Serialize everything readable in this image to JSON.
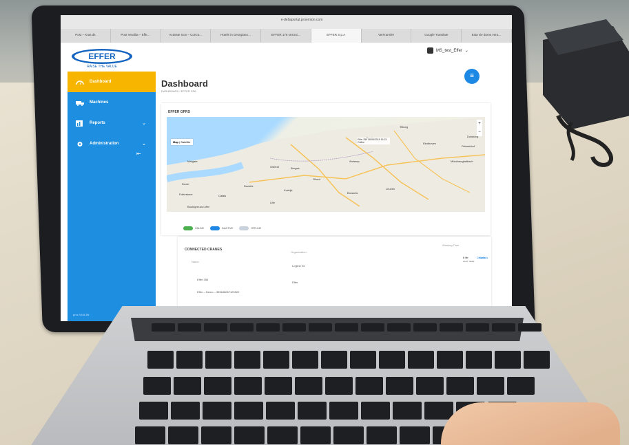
{
  "browser": {
    "url": "e-deltaportal.proemion.com",
    "tabs": [
      "Post – Kras.ds",
      "Post Vendita – Effe…",
      "Activate Icon – Conca…",
      "Hotels in Georgiano…",
      "EFFER 175 sezoni…",
      "EFFER S.p.A",
      "VetTransfer",
      "Google Translate",
      "Esta vie dome vera…"
    ],
    "active_tab_index": 5
  },
  "app": {
    "logo_text": "EFFER",
    "logo_tagline": "RAISE THE VALUE",
    "user_name": "MS_test_Effer",
    "version": "proc V4.8.3N"
  },
  "sidebar": {
    "items": [
      {
        "label": "Dashboard",
        "icon": "gauge-icon",
        "active": true
      },
      {
        "label": "Machines",
        "icon": "truck-icon",
        "active": false
      },
      {
        "label": "Reports",
        "icon": "chart-icon",
        "active": false,
        "expandable": true
      },
      {
        "label": "Administration",
        "icon": "gear-icon",
        "active": false,
        "expandable": true
      }
    ]
  },
  "page": {
    "title": "Dashboard",
    "breadcrumb": "DASHBOARD / EFFER SPA"
  },
  "map_card": {
    "title": "EFFER GPRS",
    "map_type_label": "Map",
    "map_type_alt": "Satellite",
    "places": [
      "Margate",
      "Dover",
      "Calais",
      "Boulogne-sur-Mer",
      "Dunkirk",
      "Ostend",
      "Bruges",
      "Ghent",
      "Antwerp",
      "Brussels",
      "Breda",
      "Tilburg",
      "Eindhoven",
      "Düsseldorf",
      "Mönchengladbach",
      "Duisburg",
      "Leuven",
      "Lille",
      "Kortrijk",
      "Folkestone"
    ],
    "marker_text": "Effer 355 06/06/2018 16:23 Online",
    "legend": [
      "ONLINE",
      "INACTIVE",
      "OFFLINE"
    ]
  },
  "cranes_card": {
    "title": "CONNECTED CRANES",
    "column_name": "Name",
    "column_org": "Organization",
    "column_working_time": "Working Time",
    "details_label": "Details",
    "rows": [
      {
        "name": "Effer 355",
        "org": "Logline rte",
        "working": "0 Hr",
        "working_sub": "LAST YEAR"
      },
      {
        "name": "Effer – Demo – 353648067129522",
        "org": "Effer",
        "working": "",
        "working_sub": ""
      }
    ]
  },
  "colors": {
    "sidebar": "#1e8ee0",
    "active": "#f7b500",
    "accent": "#1e88e5"
  }
}
